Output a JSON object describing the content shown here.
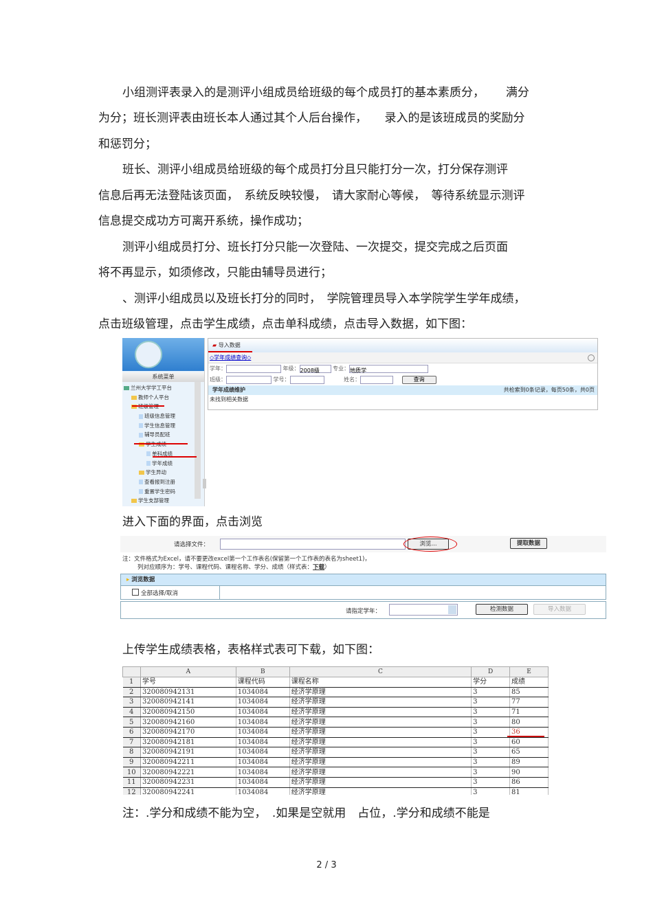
{
  "paragraphs": [
    "小组测评表录入的是测评小组成员给班级的每个成员打的基本素质分，　　 满分",
    "为分；班长测评表由班长本人通过其个人后台操作，　　录入的是该班成员的奖励分",
    "和惩罚分；",
    "班长、测评小组成员给班级的每个成员打分且只能打分一次，打分保存测评",
    "信息后再无法登陆该页面，　系统反映较慢，　请大家耐心等候，　等待系统显示测评",
    "信息提交成功方可离开系统，操作成功；",
    "测评小组成员打分、班长打分只能一次登陆、一次提交，提交完成之后页面",
    "将不再显示，如须修改，只能由辅导员进行；",
    "、测评小组成员以及班长打分的同时，　学院管理员导入本学院学生学年成绩，",
    "点击班级管理，点击学生成绩，点击单科成绩，点击导入数据，如下图："
  ],
  "caption1": "进入下面的界面，点击浏览",
  "caption2": "上传学生成绩表格，表格样式表可下载，如下图：",
  "note": "注：.学分和成绩不能为空，　.如果是空就用　占位，.学分和成绩不能是",
  "page_number": "2 / 3",
  "shot1": {
    "menu_title": "系统菜单",
    "tree": [
      {
        "label": "兰州大学学工平台",
        "indent": 0,
        "type": "root"
      },
      {
        "label": "教师个人平台",
        "indent": 1,
        "type": "folder"
      },
      {
        "label": "班级管理",
        "indent": 1,
        "type": "folder"
      },
      {
        "label": "班级信息管理",
        "indent": 2,
        "type": "doc"
      },
      {
        "label": "学生信息管理",
        "indent": 2,
        "type": "doc"
      },
      {
        "label": "辅导员配班",
        "indent": 2,
        "type": "doc"
      },
      {
        "label": "学生成绩",
        "indent": 2,
        "type": "folder"
      },
      {
        "label": "单科成绩",
        "indent": 3,
        "type": "doc"
      },
      {
        "label": "学年成绩",
        "indent": 3,
        "type": "doc"
      },
      {
        "label": "学生异动",
        "indent": 2,
        "type": "folder"
      },
      {
        "label": "查看报到注册",
        "indent": 2,
        "type": "doc"
      },
      {
        "label": "重置学生密码",
        "indent": 2,
        "type": "doc"
      },
      {
        "label": "学生支部管理",
        "indent": 1,
        "type": "folder"
      }
    ],
    "header": "导入数据",
    "link": "◇学年成绩查询◇",
    "year_label": "学年：",
    "grade_label": "年级：",
    "grade_value": "2008级",
    "major_label": "专业：",
    "major_value": "地质学",
    "class_label": "班级：",
    "student_id_label": "学号：",
    "name_label": "姓名：",
    "query_button": "查询",
    "grid_title": "学年成绩维护",
    "paging": "共检索到0条记录，每页50条，共0页",
    "no_data": "未找到相关数据"
  },
  "shot2": {
    "file_label": "请选择文件：",
    "browse_button": "浏览...",
    "extract_button": "提取数据",
    "note_line1": "注：文件格式为Excel，请不要更改excel第一个工作表名(保留第一个工作表的表名为sheet1)，",
    "note_line2": "列对应顺序为：学号、课程代码、课程名称、学分、成绩（样式表：",
    "download_link": "下载",
    "note_end": "）",
    "browse_title": "浏览数据",
    "select_all": "全部选择/取消",
    "year_label": "请指定学年：",
    "check_button": "检测数据",
    "import_button": "导入数据"
  },
  "excel": {
    "columns": [
      "A",
      "B",
      "C",
      "D",
      "E"
    ],
    "rows": [
      [
        "学号",
        "课程代码",
        "课程名称",
        "学分",
        "成绩"
      ],
      [
        "320080942131",
        "1034084",
        "经济学原理",
        "3",
        "85"
      ],
      [
        "320080942141",
        "1034084",
        "经济学原理",
        "3",
        "77"
      ],
      [
        "320080942150",
        "1034084",
        "经济学原理",
        "3",
        "71"
      ],
      [
        "320080942160",
        "1034084",
        "经济学原理",
        "3",
        "80"
      ],
      [
        "320080942170",
        "1034084",
        "经济学原理",
        "3",
        "36"
      ],
      [
        "320080942181",
        "1034084",
        "经济学原理",
        "3",
        "60"
      ],
      [
        "320080942191",
        "1034084",
        "经济学原理",
        "3",
        "65"
      ],
      [
        "320080942211",
        "1034084",
        "经济学原理",
        "3",
        "89"
      ],
      [
        "320080942221",
        "1034084",
        "经济学原理",
        "3",
        "90"
      ],
      [
        "320080942231",
        "1034084",
        "经济学原理",
        "3",
        "86"
      ],
      [
        "320080942241",
        "1034084",
        "经济学原理",
        "3",
        "81"
      ]
    ],
    "highlight_color": "#c0392b"
  }
}
